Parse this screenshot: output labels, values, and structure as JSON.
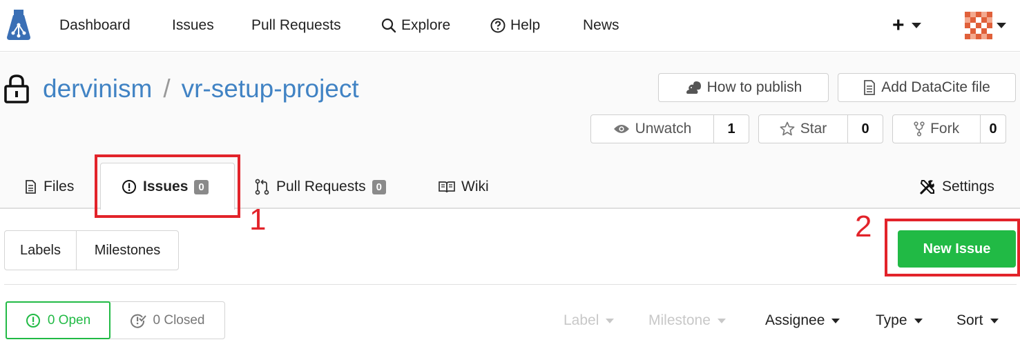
{
  "navbar": {
    "items": [
      {
        "label": "Dashboard"
      },
      {
        "label": "Issues"
      },
      {
        "label": "Pull Requests"
      },
      {
        "label": "Explore"
      },
      {
        "label": "Help"
      },
      {
        "label": "News"
      }
    ],
    "plus": "+"
  },
  "repo": {
    "owner": "dervinism",
    "separator": "/",
    "name": "vr-setup-project"
  },
  "actions": {
    "how_to_publish": "How to publish",
    "add_datacite": "Add DataCite file",
    "unwatch": "Unwatch",
    "unwatch_count": "1",
    "star": "Star",
    "star_count": "0",
    "fork": "Fork",
    "fork_count": "0"
  },
  "tabs": {
    "files": "Files",
    "issues": "Issues",
    "issues_count": "0",
    "pull_requests": "Pull Requests",
    "pull_requests_count": "0",
    "wiki": "Wiki",
    "settings": "Settings"
  },
  "issues_page": {
    "labels": "Labels",
    "milestones": "Milestones",
    "new_issue": "New Issue",
    "open": "0 Open",
    "closed": "0 Closed",
    "filters": {
      "label": "Label",
      "milestone": "Milestone",
      "assignee": "Assignee",
      "type": "Type",
      "sort": "Sort"
    }
  },
  "annotations": {
    "one": "1",
    "two": "2"
  },
  "colors": {
    "accent_link": "#4183c4",
    "new_issue_green": "#21ba45",
    "annotation_red": "#e2232a"
  }
}
